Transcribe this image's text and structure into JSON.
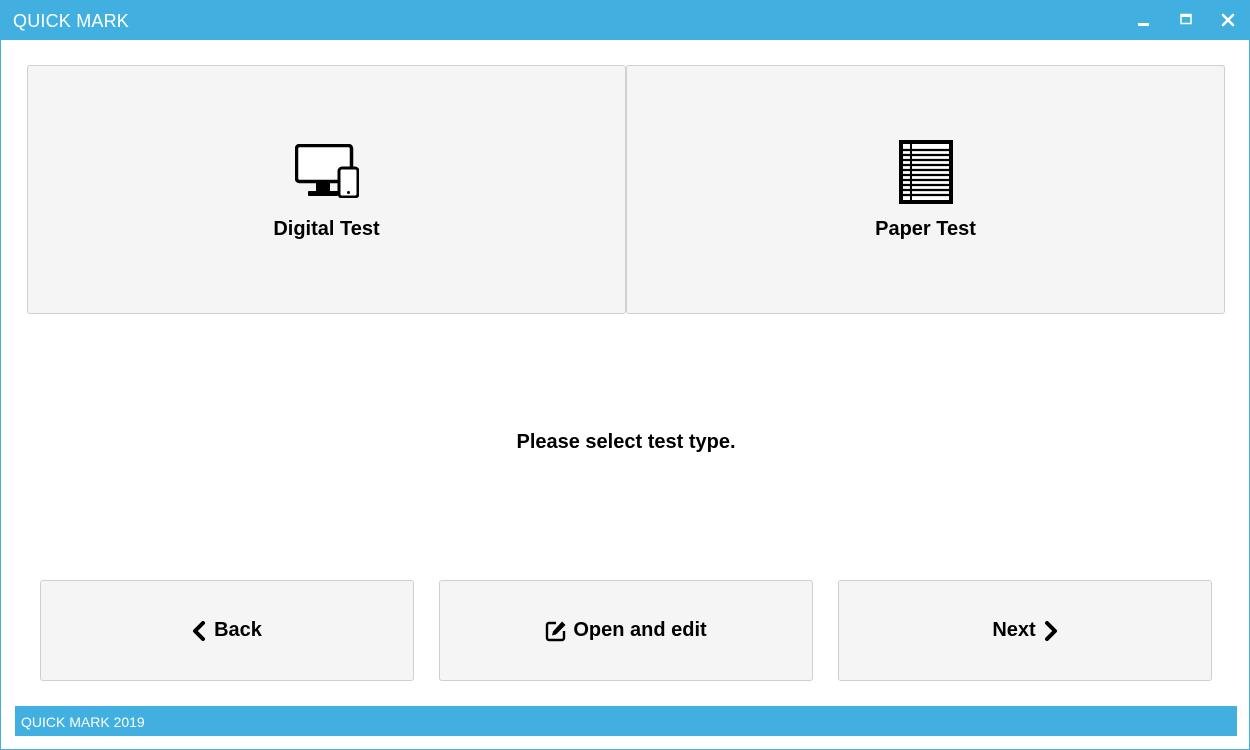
{
  "window": {
    "title": "QUICK MARK",
    "accent_color": "#41b0e1",
    "controls": {
      "minimize_icon": "minimize-icon",
      "maximize_icon": "maximize-icon",
      "close_icon": "close-icon"
    }
  },
  "test_types": [
    {
      "label": "Digital Test",
      "icon": "devices-icon"
    },
    {
      "label": "Paper Test",
      "icon": "paper-sheet-icon"
    }
  ],
  "prompt": "Please select test type.",
  "buttons": {
    "back": {
      "label": "Back",
      "icon": "chevron-left-icon"
    },
    "open_edit": {
      "label": "Open and edit",
      "icon": "edit-icon"
    },
    "next": {
      "label": "Next",
      "icon": "chevron-right-icon"
    }
  },
  "footer": {
    "text": "QUICK MARK 2019"
  }
}
